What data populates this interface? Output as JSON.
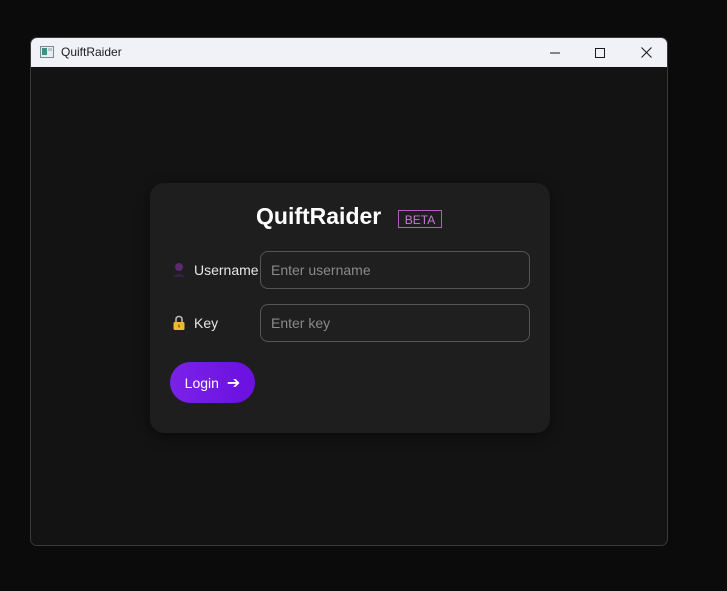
{
  "window": {
    "title": "QuiftRaider",
    "app_icon": "app-window-icon",
    "controls": {
      "minimize_icon": "minimize-icon",
      "maximize_icon": "maximize-icon",
      "close_icon": "close-icon"
    }
  },
  "login_card": {
    "title": "QuiftRaider",
    "badge": "BETA",
    "username": {
      "icon": "user-icon",
      "label": "Username",
      "value": "",
      "placeholder": "Enter username"
    },
    "key": {
      "icon": "lock-icon",
      "label": "Key",
      "value": "",
      "placeholder": "Enter key"
    },
    "login_button": {
      "label": "Login",
      "icon": "arrow-right-icon",
      "arrow_glyph": "➔"
    }
  },
  "colors": {
    "background": "#0b0b0b",
    "window_bg": "#131313",
    "card_bg": "#1e1e1e",
    "accent": "#7b22e8",
    "badge": "#c27ad0"
  }
}
